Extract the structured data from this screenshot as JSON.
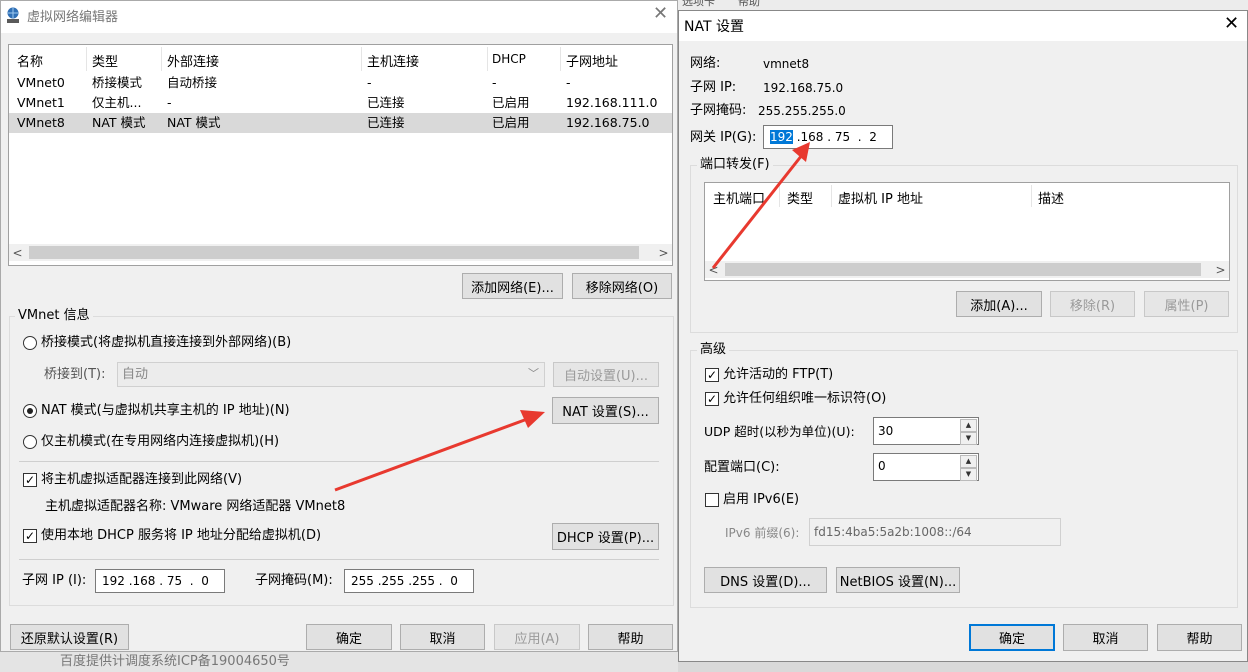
{
  "background_taskbar": {
    "top_items": [
      "选项卡",
      "帮助"
    ],
    "bottom_text": "百度提供计调度系统ICP备19004650号"
  },
  "vne": {
    "title": "虚拟网络编辑器",
    "columns": [
      "名称",
      "类型",
      "外部连接",
      "主机连接",
      "DHCP",
      "子网地址"
    ],
    "rows": [
      [
        "VMnet0",
        "桥接模式",
        "自动桥接",
        "-",
        "-",
        "-"
      ],
      [
        "VMnet1",
        "仅主机...",
        "-",
        "已连接",
        "已启用",
        "192.168.111.0"
      ],
      [
        "VMnet8",
        "NAT 模式",
        "NAT 模式",
        "已连接",
        "已启用",
        "192.168.75.0"
      ]
    ],
    "add_network": "添加网络(E)...",
    "remove_network": "移除网络(O)",
    "vmnet_info_title": "VMnet 信息",
    "bridge_mode": "桥接模式(将虚拟机直接连接到外部网络)(B)",
    "bridge_to_label": "桥接到(T):",
    "bridge_to_value": "自动",
    "auto_settings": "自动设置(U)...",
    "nat_mode": "NAT 模式(与虚拟机共享主机的 IP 地址)(N)",
    "nat_settings": "NAT 设置(S)...",
    "host_only": "仅主机模式(在专用网络内连接虚拟机)(H)",
    "connect_adapter": "将主机虚拟适配器连接到此网络(V)",
    "adapter_name": "主机虚拟适配器名称: VMware 网络适配器 VMnet8",
    "use_dhcp": "使用本地 DHCP 服务将 IP 地址分配给虚拟机(D)",
    "dhcp_settings": "DHCP 设置(P)...",
    "subnet_ip_label": "子网 IP (I):",
    "subnet_ip": "192 .168 . 75  .  0",
    "subnet_mask_label": "子网掩码(M):",
    "subnet_mask": "255 .255 .255 .  0",
    "restore": "还原默认设置(R)",
    "ok": "确定",
    "cancel": "取消",
    "apply": "应用(A)",
    "help": "帮助"
  },
  "nat": {
    "title": "NAT 设置",
    "network_label": "网络:",
    "network_value": "vmnet8",
    "subnet_ip_label": "子网 IP:",
    "subnet_ip_value": "192.168.75.0",
    "subnet_mask_label": "子网掩码:",
    "subnet_mask_value": "255.255.255.0",
    "gateway_label": "网关 IP(G):",
    "gateway_sel": "192",
    "gateway_rest": " .168 . 75  .  2",
    "port_forward_title": "端口转发(F)",
    "pf_columns": [
      "主机端口",
      "类型",
      "虚拟机 IP 地址",
      "描述"
    ],
    "pf_add": "添加(A)...",
    "pf_remove": "移除(R)",
    "pf_props": "属性(P)",
    "advanced_title": "高级",
    "allow_ftp": "允许活动的 FTP(T)",
    "allow_oui": "允许任何组织唯一标识符(O)",
    "udp_timeout_label": "UDP 超时(以秒为单位)(U):",
    "udp_timeout_value": "30",
    "config_port_label": "配置端口(C):",
    "config_port_value": "0",
    "enable_ipv6": "启用 IPv6(E)",
    "ipv6_prefix_label": "IPv6 前缀(6):",
    "ipv6_prefix_value": "fd15:4ba5:5a2b:1008::/64",
    "dns_settings": "DNS 设置(D)...",
    "netbios_settings": "NetBIOS 设置(N)...",
    "ok": "确定",
    "cancel": "取消",
    "help": "帮助"
  },
  "colors": {
    "arrow": "#e8392f",
    "selection": "#0078d7",
    "dialog_bg": "#f0f0f0"
  }
}
